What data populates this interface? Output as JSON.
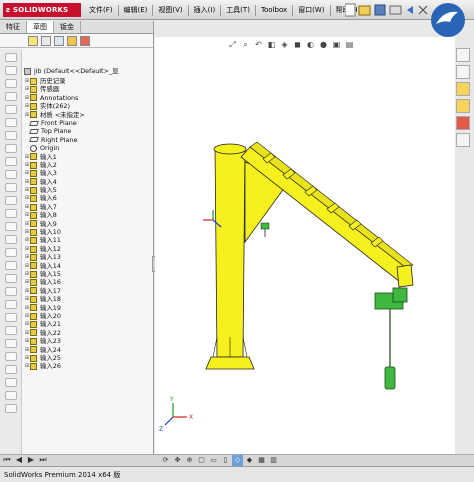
{
  "titlebar": {
    "logo_text": "SOLIDWORKS",
    "menus": [
      "文件(F)",
      "编辑(E)",
      "视图(V)",
      "插入(I)",
      "工具(T)",
      "Toolbox",
      "窗口(W)",
      "帮助(H)"
    ]
  },
  "left_panel": {
    "tabs": [
      "特征",
      "草图",
      "钣金"
    ],
    "tree_root": "jib (Default<<Default>_显",
    "tree_items": [
      {
        "label": "历史记录",
        "icon": "history-folder-icon"
      },
      {
        "label": "传感器",
        "icon": "sensor-folder-icon"
      },
      {
        "label": "Annotations",
        "icon": "annotations-icon"
      },
      {
        "label": "实体(262)",
        "icon": "solid-bodies-icon"
      },
      {
        "label": "材质 <未指定>",
        "icon": "material-icon"
      },
      {
        "label": "Front Plane",
        "icon": "plane-icon"
      },
      {
        "label": "Top Plane",
        "icon": "plane-icon"
      },
      {
        "label": "Right Plane",
        "icon": "plane-icon"
      },
      {
        "label": "Origin",
        "icon": "origin-icon"
      },
      {
        "label": "输入1",
        "icon": "imported-body-icon"
      },
      {
        "label": "输入2",
        "icon": "imported-body-icon"
      },
      {
        "label": "输入3",
        "icon": "imported-body-icon"
      },
      {
        "label": "输入4",
        "icon": "imported-body-icon"
      },
      {
        "label": "输入5",
        "icon": "imported-body-icon"
      },
      {
        "label": "输入6",
        "icon": "imported-body-icon"
      },
      {
        "label": "输入7",
        "icon": "imported-body-icon"
      },
      {
        "label": "输入8",
        "icon": "imported-body-icon"
      },
      {
        "label": "输入9",
        "icon": "imported-body-icon"
      },
      {
        "label": "输入10",
        "icon": "imported-body-icon"
      },
      {
        "label": "输入11",
        "icon": "imported-body-icon"
      },
      {
        "label": "输入12",
        "icon": "imported-body-icon"
      },
      {
        "label": "输入13",
        "icon": "imported-body-icon"
      },
      {
        "label": "输入14",
        "icon": "imported-body-icon"
      },
      {
        "label": "输入15",
        "icon": "imported-body-icon"
      },
      {
        "label": "输入16",
        "icon": "imported-body-icon"
      },
      {
        "label": "输入17",
        "icon": "imported-body-icon"
      },
      {
        "label": "输入18",
        "icon": "imported-body-icon"
      },
      {
        "label": "输入19",
        "icon": "imported-body-icon"
      },
      {
        "label": "输入20",
        "icon": "imported-body-icon"
      },
      {
        "label": "输入21",
        "icon": "imported-body-icon"
      },
      {
        "label": "输入22",
        "icon": "imported-body-icon"
      },
      {
        "label": "输入23",
        "icon": "imported-body-icon"
      },
      {
        "label": "输入24",
        "icon": "imported-body-icon"
      },
      {
        "label": "输入25",
        "icon": "imported-body-icon"
      },
      {
        "label": "输入26",
        "icon": "imported-body-icon"
      }
    ]
  },
  "viewport": {
    "background": "#ffffff",
    "model_color": "#f5f01e",
    "hoist_color": "#3fb83f",
    "triad_labels": [
      "X",
      "Y",
      "Z"
    ]
  },
  "status": {
    "text": "SolidWorks Premium 2014 x64 版"
  },
  "colors": {
    "accent": "#c8102e",
    "selection": "#6ea0d8"
  }
}
